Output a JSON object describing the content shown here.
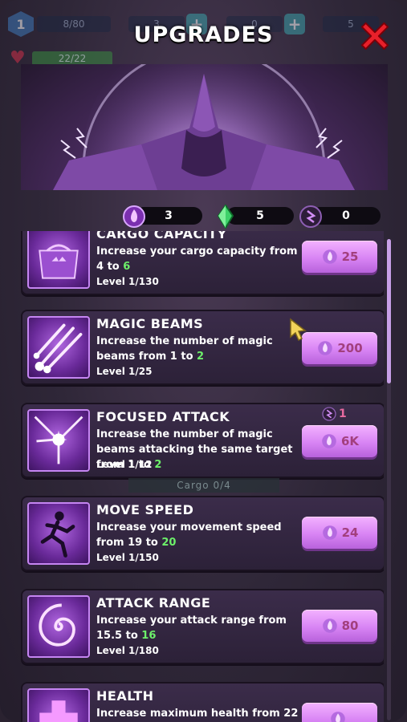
{
  "title": "UPGRADES",
  "hud": {
    "level": "1",
    "xp": "8/80",
    "resource_1": "3",
    "resource_2": "0",
    "resource_3": "5",
    "health": "22/22"
  },
  "currencies": [
    {
      "icon": "purple-flame-orb-icon",
      "value": "3"
    },
    {
      "icon": "green-crystal-icon",
      "value": "5"
    },
    {
      "icon": "dark-rune-icon",
      "value": "0"
    }
  ],
  "cargo_overlay": "Cargo 0/4",
  "upgrades": [
    {
      "id": "cargo",
      "name": "CARGO CAPACITY",
      "desc_pre": "Increase your cargo capacity from",
      "desc_from": "4",
      "desc_to": "6",
      "level": "Level 1/130",
      "price": "25"
    },
    {
      "id": "magic-beams",
      "name": "MAGIC BEAMS",
      "desc_pre": "Increase the number of magic beams from",
      "desc_from": "1",
      "desc_to": "2",
      "level": "Level 1/25",
      "price": "200"
    },
    {
      "id": "focused-attack",
      "name": "FOCUSED ATTACK",
      "desc_pre": "Increase the number of magic beams attacking the same target from",
      "desc_from": "1",
      "desc_to": "2",
      "level": "Level 1/12",
      "price": "6K",
      "requirement": "1"
    },
    {
      "id": "move-speed",
      "name": "MOVE SPEED",
      "desc_pre": "Increase your movement speed from",
      "desc_from": "19",
      "desc_to": "20",
      "level": "Level 1/150",
      "price": "24"
    },
    {
      "id": "attack-range",
      "name": "ATTACK RANGE",
      "desc_pre": "Increase your attack range from",
      "desc_from": "15.5",
      "desc_to": "16",
      "level": "Level 1/180",
      "price": "80"
    },
    {
      "id": "health",
      "name": "HEALTH",
      "desc_pre": "Increase maximum health from",
      "desc_from": "22",
      "desc_to": "",
      "level": "",
      "price": ""
    }
  ],
  "colors": {
    "accent": "#d884f4",
    "increase": "#6df06a",
    "price": "#a23f7d"
  }
}
